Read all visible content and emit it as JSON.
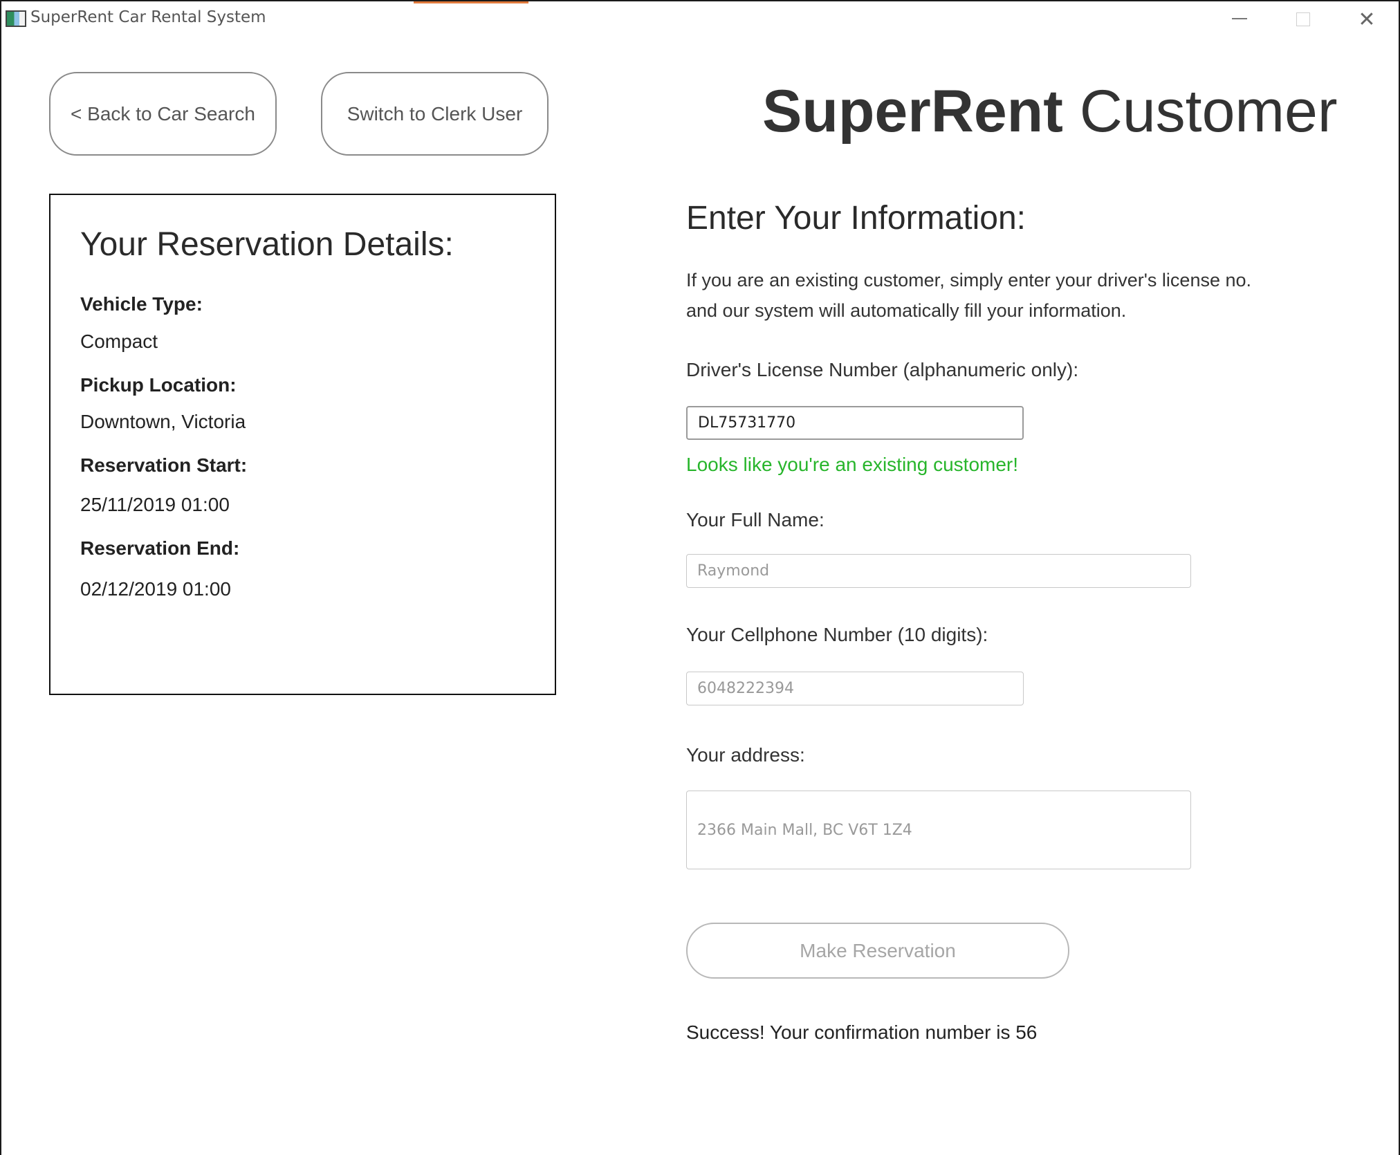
{
  "window": {
    "title": "SuperRent Car Rental System"
  },
  "nav": {
    "back_label": "< Back to Car Search",
    "clerk_label": "Switch to Clerk User"
  },
  "header": {
    "brand": "SuperRent",
    "role": "Customer"
  },
  "reservation": {
    "heading": "Your Reservation Details:",
    "vehicle_type_label": "Vehicle Type:",
    "vehicle_type": "Compact",
    "pickup_label": "Pickup Location:",
    "pickup": "Downtown, Victoria",
    "start_label": "Reservation Start:",
    "start": "25/11/2019 01:00",
    "end_label": "Reservation End:",
    "end": "02/12/2019 01:00"
  },
  "form": {
    "heading": "Enter Your Information:",
    "intro_line1": "If you are an existing customer, simply enter your driver's license no.",
    "intro_line2": "and our system will automatically fill your information.",
    "license_label": "Driver's License Number (alphanumeric only):",
    "license_value": "DL75731770",
    "existing_msg": "Looks like you're an existing customer!",
    "name_label": "Your Full Name:",
    "name_value": "Raymond",
    "phone_label": "Your Cellphone Number (10 digits):",
    "phone_value": "6048222394",
    "address_label": "Your address:",
    "address_value": "2366 Main Mall, BC V6T 1Z4",
    "submit_label": "Make Reservation",
    "success_msg": "Success! Your confirmation number is 56"
  },
  "colors": {
    "success_green": "#27b52b",
    "border": "#8a8a8a",
    "disabled_text": "#a6a6a6"
  },
  "icons": {
    "app": "app-window-icon",
    "minimize": "minimize-icon",
    "maximize": "maximize-icon",
    "close": "close-icon"
  }
}
